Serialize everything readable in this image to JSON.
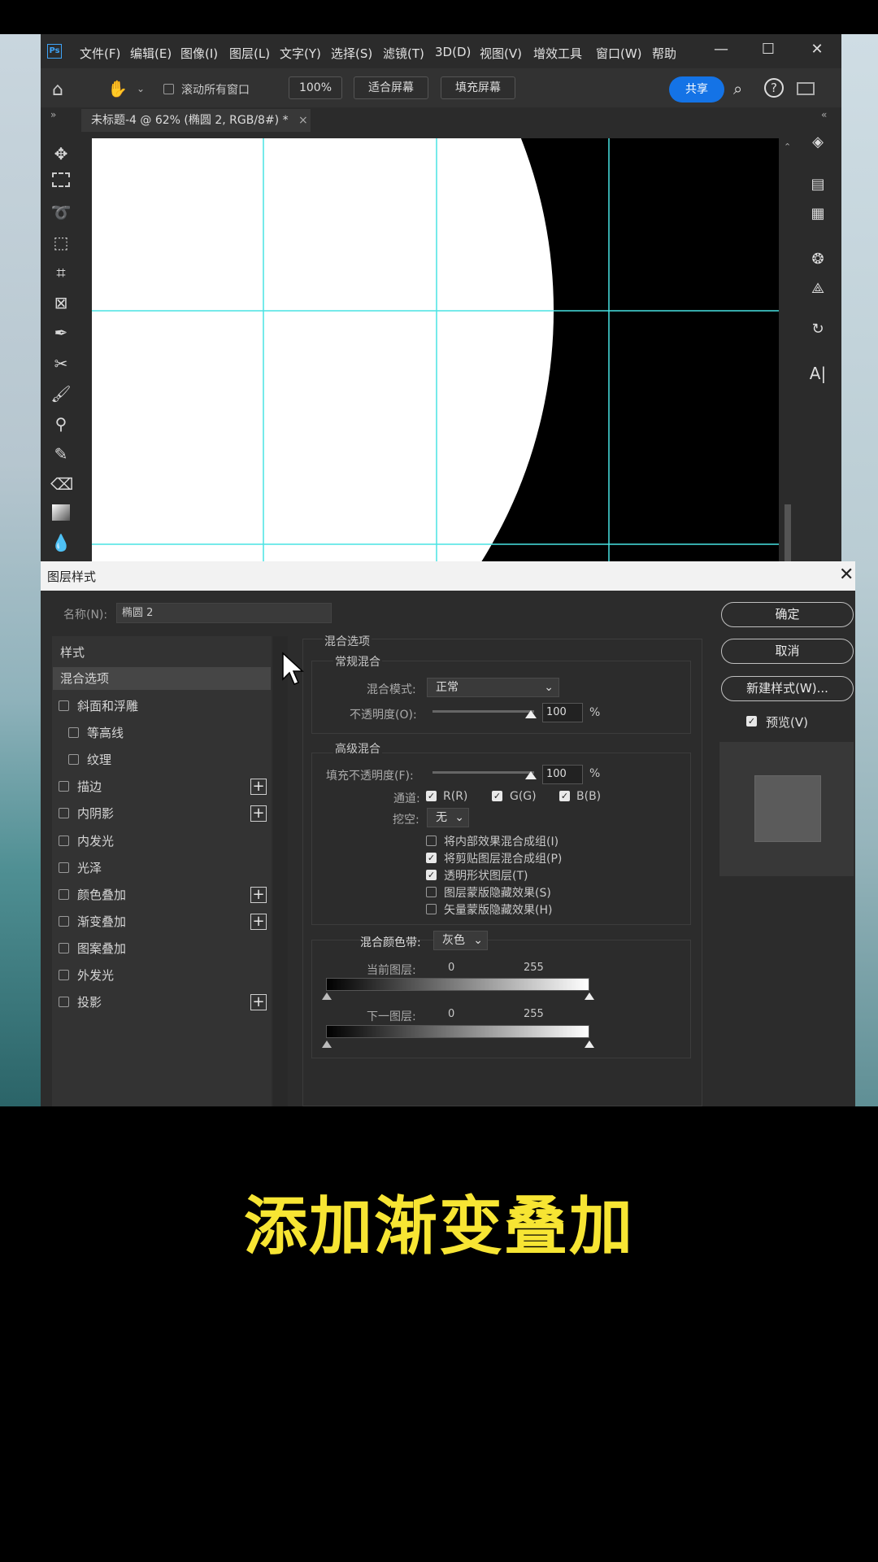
{
  "app": {
    "logo": "Ps",
    "menu": [
      "文件(F)",
      "编辑(E)",
      "图像(I)",
      "图层(L)",
      "文字(Y)",
      "选择(S)",
      "滤镜(T)",
      "3D(D)",
      "视图(V)",
      "增效工具",
      "窗口(W)",
      "帮助"
    ],
    "window_controls": {
      "minimize": "—",
      "maximize": "☐",
      "close": "✕"
    }
  },
  "options": {
    "scroll_all_label": "滚动所有窗口",
    "zoom": "100%",
    "fit_screen": "适合屏幕",
    "fill_screen": "填充屏幕",
    "share": "共享"
  },
  "document": {
    "tab_title": "未标题-4 @ 62% (椭圆 2, RGB/8#) *",
    "tab_close": "×"
  },
  "dialog": {
    "title": "图层样式",
    "name_label": "名称(N):",
    "name_value": "椭圆 2",
    "styles_header": "样式",
    "styles": [
      {
        "label": "混合选项",
        "checkbox": false,
        "plus": false,
        "indent": false,
        "selected": true
      },
      {
        "label": "斜面和浮雕",
        "checkbox": true,
        "plus": false,
        "indent": false
      },
      {
        "label": "等高线",
        "checkbox": true,
        "plus": false,
        "indent": true
      },
      {
        "label": "纹理",
        "checkbox": true,
        "plus": false,
        "indent": true
      },
      {
        "label": "描边",
        "checkbox": true,
        "plus": true,
        "indent": false
      },
      {
        "label": "内阴影",
        "checkbox": true,
        "plus": true,
        "indent": false
      },
      {
        "label": "内发光",
        "checkbox": true,
        "plus": false,
        "indent": false
      },
      {
        "label": "光泽",
        "checkbox": true,
        "plus": false,
        "indent": false
      },
      {
        "label": "颜色叠加",
        "checkbox": true,
        "plus": true,
        "indent": false
      },
      {
        "label": "渐变叠加",
        "checkbox": true,
        "plus": true,
        "indent": false
      },
      {
        "label": "图案叠加",
        "checkbox": true,
        "plus": false,
        "indent": false
      },
      {
        "label": "外发光",
        "checkbox": true,
        "plus": false,
        "indent": false
      },
      {
        "label": "投影",
        "checkbox": true,
        "plus": true,
        "indent": false
      }
    ],
    "blend_options_title": "混合选项",
    "general_blending": "常规混合",
    "blend_mode_label": "混合模式:",
    "blend_mode_value": "正常",
    "opacity_label": "不透明度(O):",
    "opacity_value": "100",
    "percent": "%",
    "advanced_blending": "高级混合",
    "fill_opacity_label": "填充不透明度(F):",
    "fill_opacity_value": "100",
    "channels_label": "通道:",
    "channels": [
      "R(R)",
      "G(G)",
      "B(B)"
    ],
    "knockout_label": "挖空:",
    "knockout_value": "无",
    "advanced_checks": [
      {
        "label": "将内部效果混合成组(I)",
        "checked": false
      },
      {
        "label": "将剪贴图层混合成组(P)",
        "checked": true
      },
      {
        "label": "透明形状图层(T)",
        "checked": true
      },
      {
        "label": "图层蒙版隐藏效果(S)",
        "checked": false
      },
      {
        "label": "矢量蒙版隐藏效果(H)",
        "checked": false
      }
    ],
    "blend_if_label": "混合颜色带:",
    "blend_if_value": "灰色",
    "this_layer": "当前图层:",
    "underlying_layer": "下一图层:",
    "range_min": "0",
    "range_max": "255",
    "ok": "确定",
    "cancel": "取消",
    "new_style": "新建样式(W)...",
    "preview": "预览(V)"
  },
  "caption": "添加渐变叠加"
}
